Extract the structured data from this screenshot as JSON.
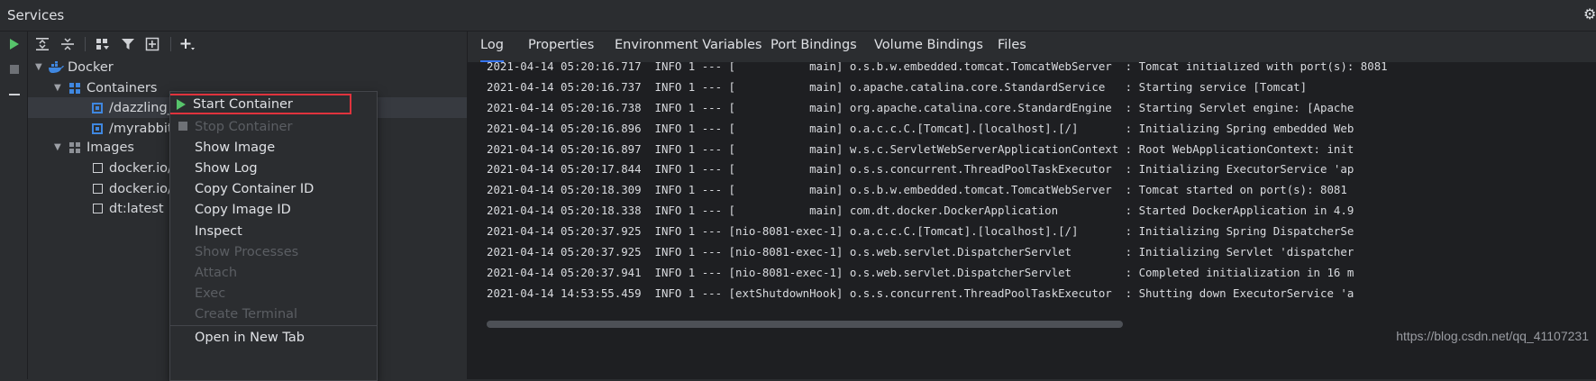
{
  "window": {
    "title": "Services"
  },
  "top_toolbar": {
    "buttons": [
      "expand-all",
      "collapse-all",
      "group-by",
      "filter",
      "new-service",
      "add"
    ]
  },
  "tree": {
    "root": "Docker",
    "containers_label": "Containers",
    "containers": [
      "/dazzling_n",
      "/myrabbitm"
    ],
    "images_label": "Images",
    "images": [
      "docker.io/j",
      "docker.io/(",
      "dt:latest"
    ]
  },
  "context_menu": {
    "items": [
      {
        "label": "Start Container",
        "enabled": true,
        "icon": "play-icon"
      },
      {
        "label": "Stop Container",
        "enabled": false,
        "icon": "stop-icon"
      },
      {
        "label": "Show Image",
        "enabled": true
      },
      {
        "label": "Show Log",
        "enabled": true
      },
      {
        "label": "Copy Container ID",
        "enabled": true
      },
      {
        "label": "Copy Image ID",
        "enabled": true
      },
      {
        "label": "Inspect",
        "enabled": true
      },
      {
        "label": "Show Processes",
        "enabled": false
      },
      {
        "label": "Attach",
        "enabled": false
      },
      {
        "label": "Exec",
        "enabled": false
      },
      {
        "label": "Create Terminal",
        "enabled": false
      },
      {
        "label": "Open in New Tab",
        "enabled": true
      }
    ]
  },
  "tabs": [
    "Log",
    "Properties",
    "Environment Variables",
    "Port Bindings",
    "Volume Bindings",
    "Files"
  ],
  "log_lines": [
    "2021-04-14 05:20:16.717  INFO 1 --- [           main] o.s.b.w.embedded.tomcat.TomcatWebServer  : Tomcat initialized with port(s): 8081",
    "2021-04-14 05:20:16.737  INFO 1 --- [           main] o.apache.catalina.core.StandardService   : Starting service [Tomcat]",
    "2021-04-14 05:20:16.738  INFO 1 --- [           main] org.apache.catalina.core.StandardEngine  : Starting Servlet engine: [Apache",
    "2021-04-14 05:20:16.896  INFO 1 --- [           main] o.a.c.c.C.[Tomcat].[localhost].[/]       : Initializing Spring embedded Web",
    "2021-04-14 05:20:16.897  INFO 1 --- [           main] w.s.c.ServletWebServerApplicationContext : Root WebApplicationContext: init",
    "2021-04-14 05:20:17.844  INFO 1 --- [           main] o.s.s.concurrent.ThreadPoolTaskExecutor  : Initializing ExecutorService 'ap",
    "2021-04-14 05:20:18.309  INFO 1 --- [           main] o.s.b.w.embedded.tomcat.TomcatWebServer  : Tomcat started on port(s): 8081",
    "2021-04-14 05:20:18.338  INFO 1 --- [           main] com.dt.docker.DockerApplication          : Started DockerApplication in 4.9",
    "2021-04-14 05:20:37.925  INFO 1 --- [nio-8081-exec-1] o.a.c.c.C.[Tomcat].[localhost].[/]       : Initializing Spring DispatcherSe",
    "2021-04-14 05:20:37.925  INFO 1 --- [nio-8081-exec-1] o.s.web.servlet.DispatcherServlet        : Initializing Servlet 'dispatcher",
    "2021-04-14 05:20:37.941  INFO 1 --- [nio-8081-exec-1] o.s.web.servlet.DispatcherServlet        : Completed initialization in 16 m",
    "2021-04-14 14:53:55.459  INFO 1 --- [extShutdownHook] o.s.s.concurrent.ThreadPoolTaskExecutor  : Shutting down ExecutorService 'a"
  ],
  "watermark": "https://blog.csdn.net/qq_41107231",
  "colors": {
    "accent_blue": "#3574f0",
    "run_green": "#57c46b",
    "highlight_red": "#e0333d",
    "panel_bg": "#2b2d30",
    "log_bg": "#1e1f22"
  }
}
